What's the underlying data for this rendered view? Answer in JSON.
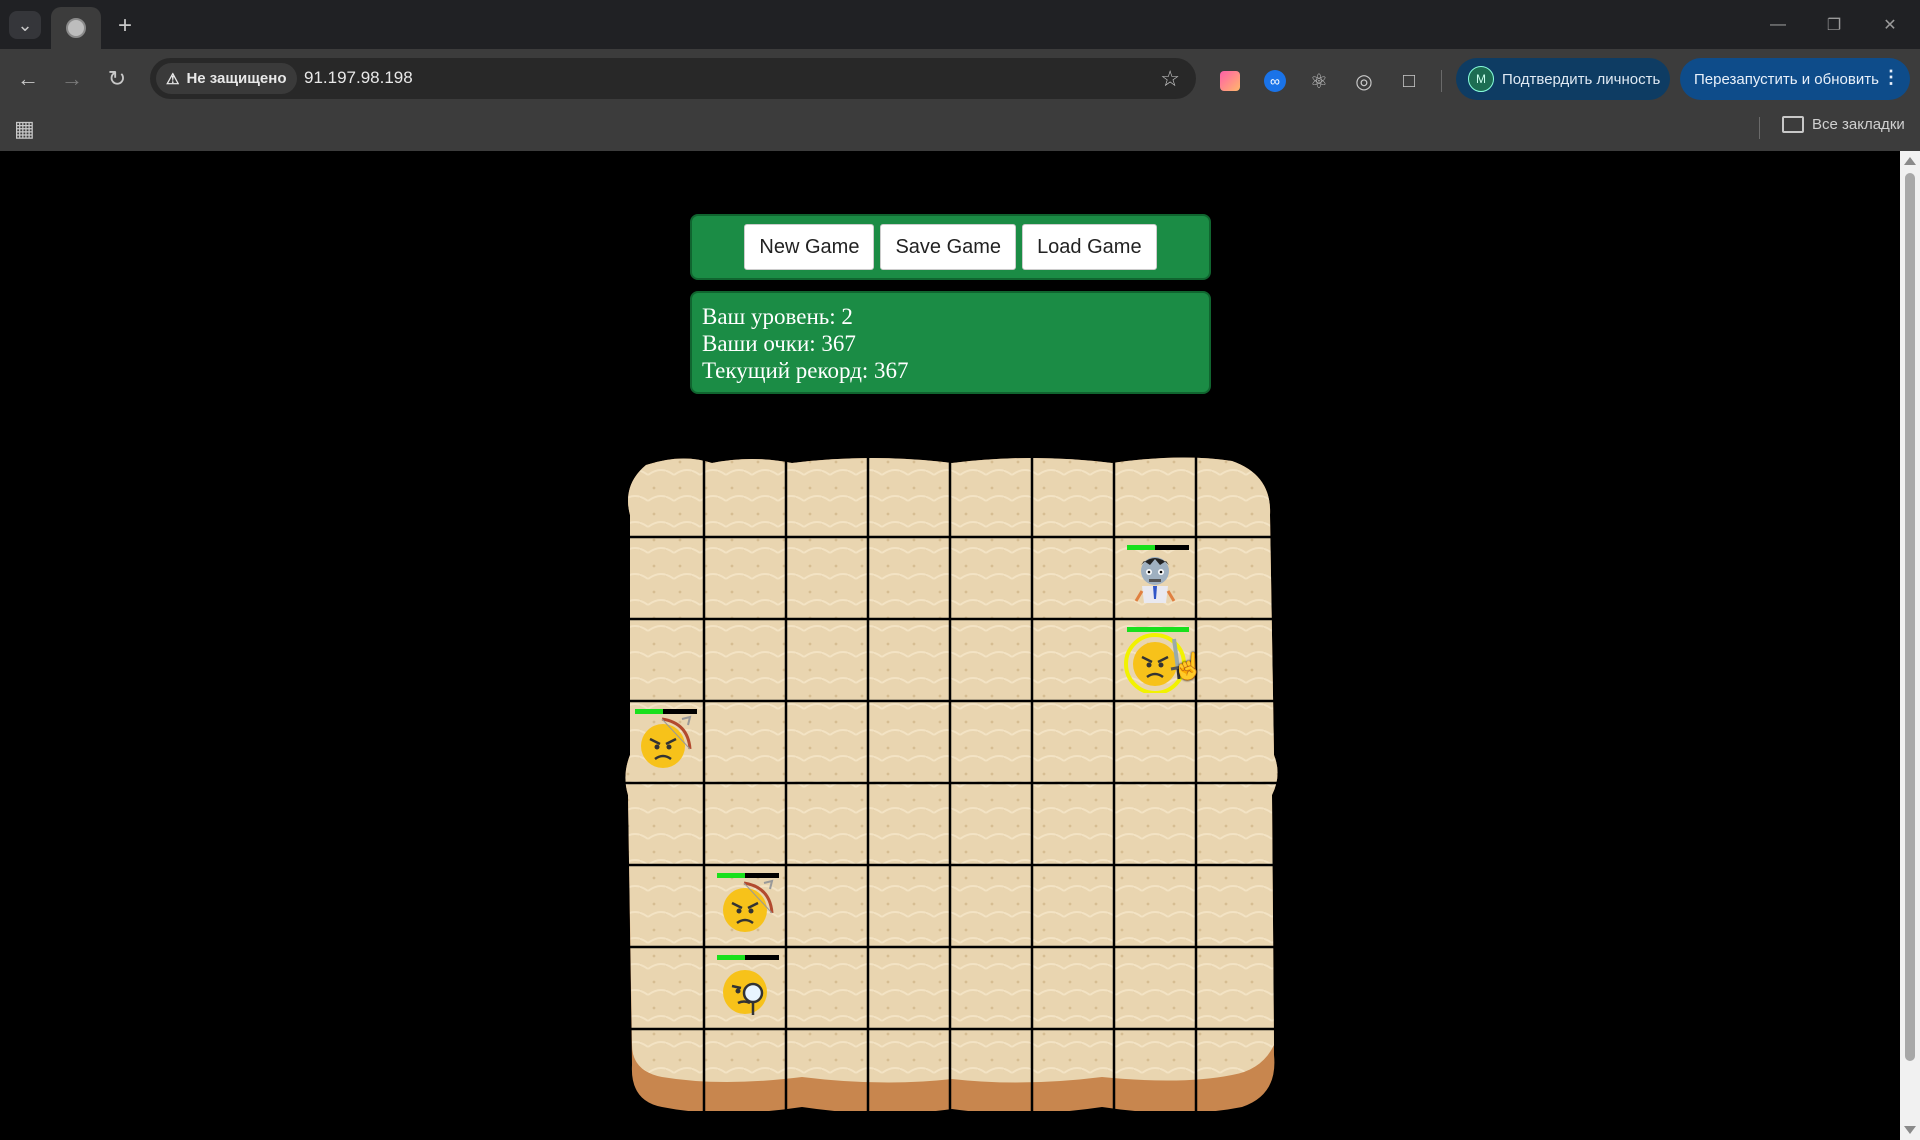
{
  "browser": {
    "security_label": "Не защищено",
    "url": "91.197.98.198",
    "verify_button": "Подтвердить личность",
    "verify_avatar_letter": "M",
    "relaunch_button": "Перезапустить и обновить",
    "all_bookmarks": "Все закладки"
  },
  "controls": {
    "new_game": "New Game",
    "save_game": "Save Game",
    "load_game": "Load Game"
  },
  "stats": {
    "level_text": "Ваш уровень: 2",
    "score_text": "Ваши очки: 367",
    "record_text": "Текущий рекорд: 367"
  },
  "board": {
    "size": 8,
    "theme_colors": {
      "sand": "#e9d5b0",
      "sand_dark": "#d8c196",
      "grid": "#000000",
      "edge": "#c8864e",
      "selection": "#f2f200",
      "hp": "#19e01c",
      "panel": "#1b8c45"
    },
    "units": [
      {
        "name": "undead",
        "icon": "zombie-icon",
        "row": 1,
        "col": 6,
        "health": 0.45
      },
      {
        "name": "swordsman",
        "icon": "swordsman-icon",
        "row": 2,
        "col": 6,
        "health": 1.0,
        "selected": true
      },
      {
        "name": "bowman",
        "icon": "bowman-icon",
        "row": 3,
        "col": 0,
        "health": 0.45
      },
      {
        "name": "bowman",
        "icon": "bowman-icon",
        "row": 5,
        "col": 1,
        "health": 0.45
      },
      {
        "name": "magician",
        "icon": "magician-icon",
        "row": 6,
        "col": 1,
        "health": 0.45
      }
    ]
  }
}
